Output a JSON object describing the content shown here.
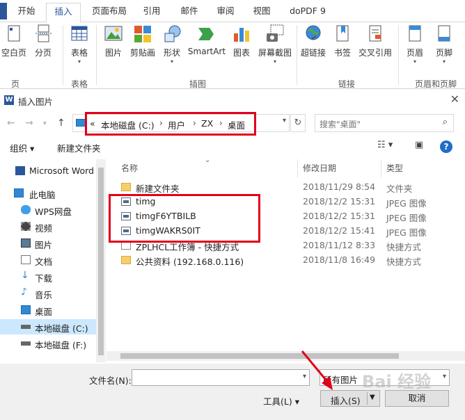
{
  "ribbon": {
    "tabs": [
      {
        "label": "开始"
      },
      {
        "label": "插入"
      },
      {
        "label": "页面布局"
      },
      {
        "label": "引用"
      },
      {
        "label": "邮件"
      },
      {
        "label": "审阅"
      },
      {
        "label": "视图"
      },
      {
        "label": "doPDF 9"
      }
    ],
    "buttons": {
      "blank_page": "空白页",
      "page_break": "分页",
      "table": "表格",
      "picture": "图片",
      "clipart": "剪贴画",
      "shapes": "形状",
      "smartart": "SmartArt",
      "chart": "图表",
      "screenshot": "屏幕截图",
      "hyperlink": "超链接",
      "bookmark": "书签",
      "crossref": "交叉引用",
      "header": "页眉",
      "footer": "页脚"
    },
    "groups": {
      "pages": "页",
      "tables": "表格",
      "illustrations": "插图",
      "links": "链接",
      "header_footer": "页眉和页脚"
    }
  },
  "dialog": {
    "title": "插入图片",
    "title_icon": "W",
    "address": {
      "overflow": "«",
      "segments": [
        "本地磁盘 (C:)",
        "用户",
        "ZX",
        "桌面"
      ]
    },
    "search_placeholder": "搜索\"桌面\"",
    "toolbar": {
      "organize": "组织 ▾",
      "new_folder": "新建文件夹"
    },
    "nav_items": [
      {
        "label": "Microsoft Word",
        "icon": "word-icon"
      },
      {
        "label": "此电脑",
        "icon": "computer-icon"
      },
      {
        "label": "WPS网盘",
        "icon": "cloud-icon"
      },
      {
        "label": "视频",
        "icon": "video-icon"
      },
      {
        "label": "图片",
        "icon": "pictures-icon"
      },
      {
        "label": "文档",
        "icon": "documents-icon"
      },
      {
        "label": "下载",
        "icon": "download-icon"
      },
      {
        "label": "音乐",
        "icon": "music-icon"
      },
      {
        "label": "桌面",
        "icon": "desktop-icon"
      },
      {
        "label": "本地磁盘 (C:)",
        "icon": "drive-icon"
      },
      {
        "label": "本地磁盘 (F:)",
        "icon": "drive-icon"
      }
    ],
    "columns": {
      "name": "名称",
      "date": "修改日期",
      "type": "类型"
    },
    "files": [
      {
        "name": "新建文件夹",
        "date": "2018/11/29 8:54",
        "type": "文件夹",
        "icon": "folder-icon"
      },
      {
        "name": "timg",
        "date": "2018/12/2 15:31",
        "type": "JPEG 图像",
        "icon": "image-icon"
      },
      {
        "name": "timgF6YTBILB",
        "date": "2018/12/2 15:31",
        "type": "JPEG 图像",
        "icon": "image-icon"
      },
      {
        "name": "timgWAKRS0IT",
        "date": "2018/12/2 15:41",
        "type": "JPEG 图像",
        "icon": "image-icon"
      },
      {
        "name": "ZPLHCL工作簿 - 快捷方式",
        "date": "2018/11/12 8:33",
        "type": "快捷方式",
        "icon": "shortcut-icon"
      },
      {
        "name": "公共资料 (192.168.0.116)",
        "date": "2018/11/8 16:49",
        "type": "快捷方式",
        "icon": "shortcut-icon"
      }
    ],
    "filename_label": "文件名(N):",
    "filename_value": "",
    "filetype": "所有图片",
    "tools": "工具(L) ▾",
    "insert": "插入(S)",
    "cancel": "取消",
    "watermark": "Bai 经验"
  },
  "colors": {
    "accent": "#2b579a",
    "annotation_red": "#e2001a",
    "selected_nav": "#cce8ff"
  }
}
